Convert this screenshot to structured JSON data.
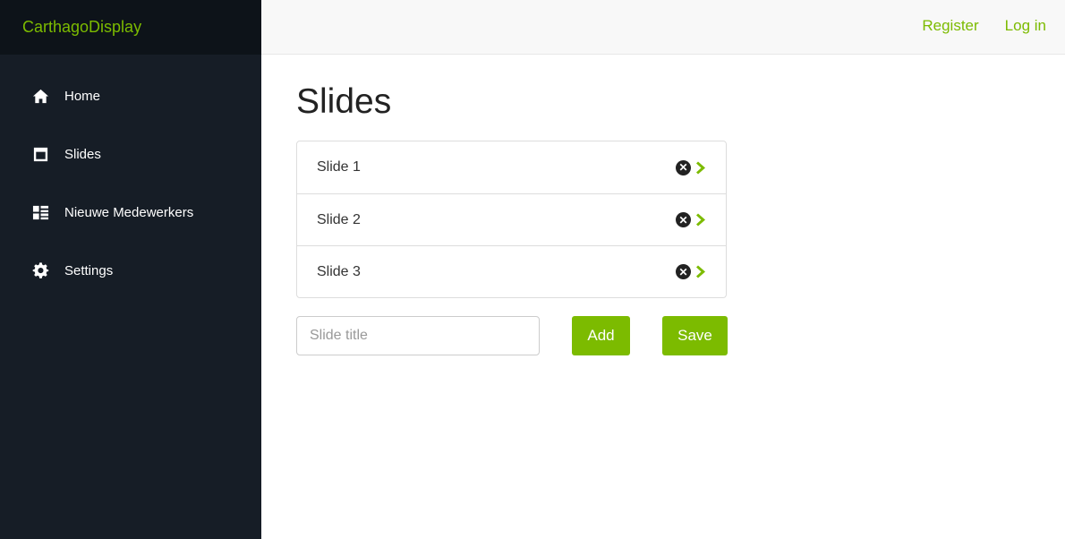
{
  "brand": {
    "name": "CarthagoDisplay"
  },
  "topnav": {
    "register": "Register",
    "login": "Log in"
  },
  "sidebar": {
    "items": [
      {
        "label": "Home",
        "icon": "home-icon"
      },
      {
        "label": "Slides",
        "icon": "window-icon"
      },
      {
        "label": "Nieuwe Medewerkers",
        "icon": "list-grid-icon"
      },
      {
        "label": "Settings",
        "icon": "gear-icon"
      }
    ]
  },
  "main": {
    "title": "Slides",
    "slides": [
      {
        "label": "Slide 1"
      },
      {
        "label": "Slide 2"
      },
      {
        "label": "Slide 3"
      }
    ],
    "input": {
      "placeholder": "Slide title",
      "value": ""
    },
    "add_label": "Add",
    "save_label": "Save"
  },
  "colors": {
    "accent": "#7cbb00",
    "sidebar_bg": "#161d26",
    "brand_bg": "#0d1319"
  }
}
